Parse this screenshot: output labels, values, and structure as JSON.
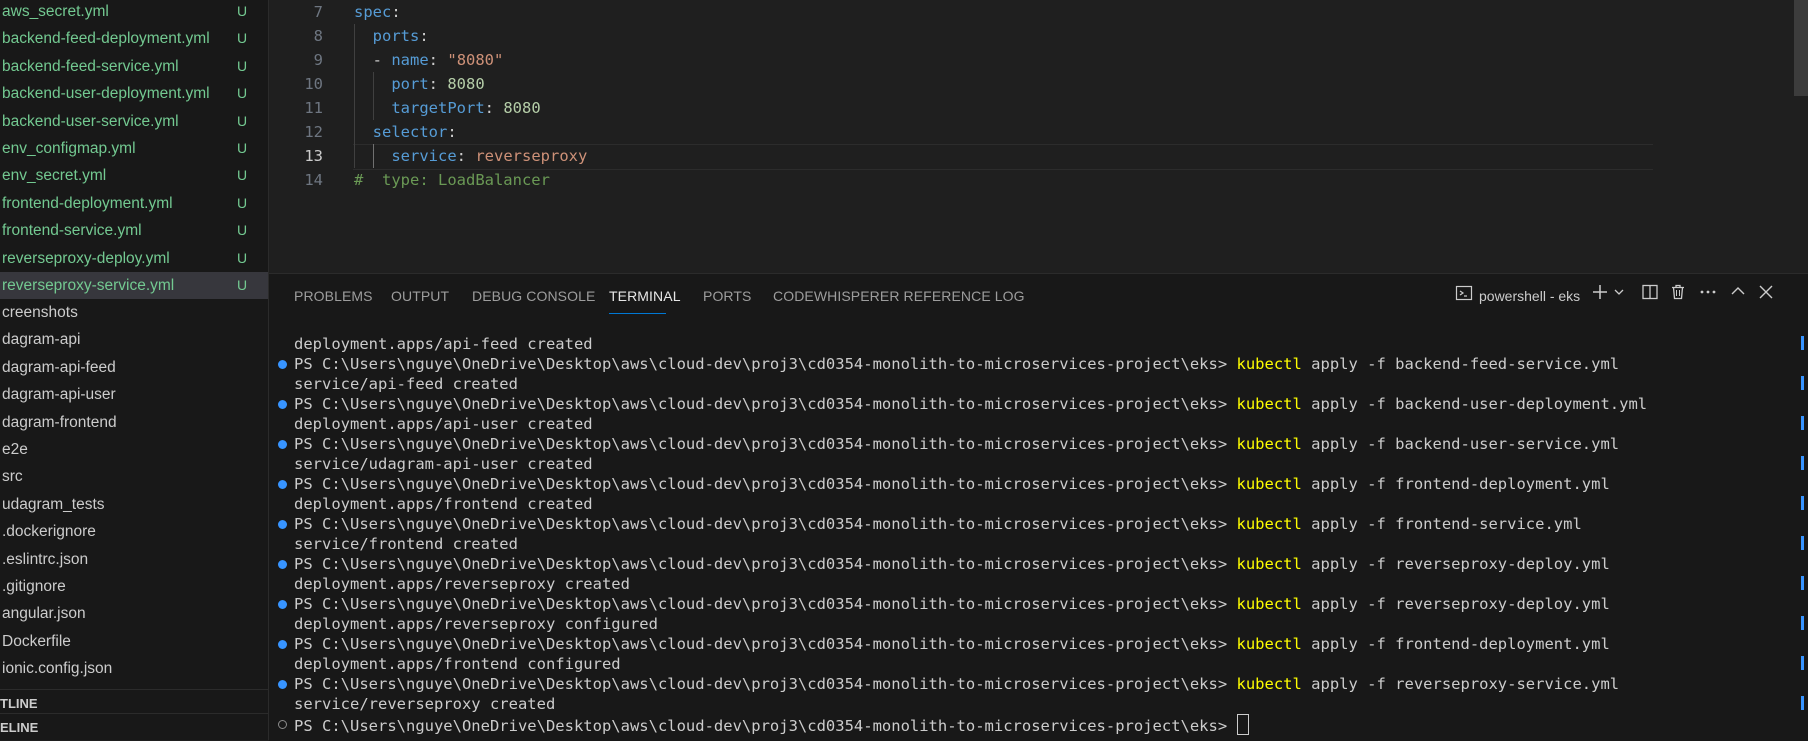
{
  "explorer": {
    "files": [
      {
        "name": "aws_secret.yml",
        "badge": "U"
      },
      {
        "name": "backend-feed-deployment.yml",
        "badge": "U"
      },
      {
        "name": "backend-feed-service.yml",
        "badge": "U"
      },
      {
        "name": "backend-user-deployment.yml",
        "badge": "U"
      },
      {
        "name": "backend-user-service.yml",
        "badge": "U"
      },
      {
        "name": "env_configmap.yml",
        "badge": "U"
      },
      {
        "name": "env_secret.yml",
        "badge": "U"
      },
      {
        "name": "frontend-deployment.yml",
        "badge": "U"
      },
      {
        "name": "frontend-service.yml",
        "badge": "U"
      },
      {
        "name": "reverseproxy-deploy.yml",
        "badge": "U"
      },
      {
        "name": "reverseproxy-service.yml",
        "badge": "U"
      }
    ],
    "folders": [
      "creenshots",
      "dagram-api",
      "dagram-api-feed",
      "dagram-api-user",
      "dagram-frontend",
      "e2e",
      "src",
      "udagram_tests",
      ".dockerignore",
      ".eslintrc.json",
      ".gitignore",
      "angular.json",
      "Dockerfile",
      "ionic.config.json"
    ],
    "outline_label": "TLINE",
    "timeline_label": "ELINE"
  },
  "editor": {
    "lines": [
      {
        "num": "7",
        "text": "spec:"
      },
      {
        "num": "8",
        "text": "  ports:"
      },
      {
        "num": "9",
        "text": "  - name: \"8080\""
      },
      {
        "num": "10",
        "text": "    port: 8080"
      },
      {
        "num": "11",
        "text": "    targetPort: 8080"
      },
      {
        "num": "12",
        "text": "  selector:"
      },
      {
        "num": "13",
        "text": "    service: reverseproxy"
      },
      {
        "num": "14",
        "text": "#  type: LoadBalancer"
      }
    ]
  },
  "panel": {
    "tabs": [
      "PROBLEMS",
      "OUTPUT",
      "DEBUG CONSOLE",
      "TERMINAL",
      "PORTS",
      "CODEWHISPERER REFERENCE LOG"
    ],
    "active_tab": "TERMINAL",
    "terminal_name": "powershell - eks"
  },
  "terminal": {
    "prompt": "PS C:\\Users\\nguye\\OneDrive\\Desktop\\aws\\cloud-dev\\proj3\\cd0354-monolith-to-microservices-project\\eks> ",
    "first_output": "deployment.apps/api-feed created",
    "entries": [
      {
        "cmd": "kubectl",
        "args": " apply -f backend-feed-service.yml",
        "output": "service/api-feed created"
      },
      {
        "cmd": "kubectl",
        "args": " apply -f backend-user-deployment.yml",
        "output": "deployment.apps/api-user created"
      },
      {
        "cmd": "kubectl",
        "args": " apply -f backend-user-service.yml",
        "output": "service/udagram-api-user created"
      },
      {
        "cmd": "kubectl",
        "args": " apply -f frontend-deployment.yml",
        "output": "deployment.apps/frontend created"
      },
      {
        "cmd": "kubectl",
        "args": " apply -f frontend-service.yml",
        "output": "service/frontend created"
      },
      {
        "cmd": "kubectl",
        "args": " apply -f reverseproxy-deploy.yml",
        "output": "deployment.apps/reverseproxy created"
      },
      {
        "cmd": "kubectl",
        "args": " apply -f reverseproxy-deploy.yml",
        "output": "deployment.apps/reverseproxy configured"
      },
      {
        "cmd": "kubectl",
        "args": " apply -f frontend-deployment.yml",
        "output": "deployment.apps/frontend configured"
      },
      {
        "cmd": "kubectl",
        "args": " apply -f reverseproxy-service.yml",
        "output": "service/reverseproxy created"
      }
    ]
  },
  "colors": {
    "untracked": "#73c991",
    "keyword": "#569cd6",
    "string": "#ce9178",
    "number": "#b5cea8",
    "comment": "#6a9955",
    "command": "#ffff00",
    "accent": "#0078d4"
  },
  "icons": [
    "terminal-icon",
    "plus-icon",
    "chevron-down-icon",
    "split-icon",
    "trash-icon",
    "more-icon",
    "chevron-up-icon",
    "close-icon"
  ]
}
